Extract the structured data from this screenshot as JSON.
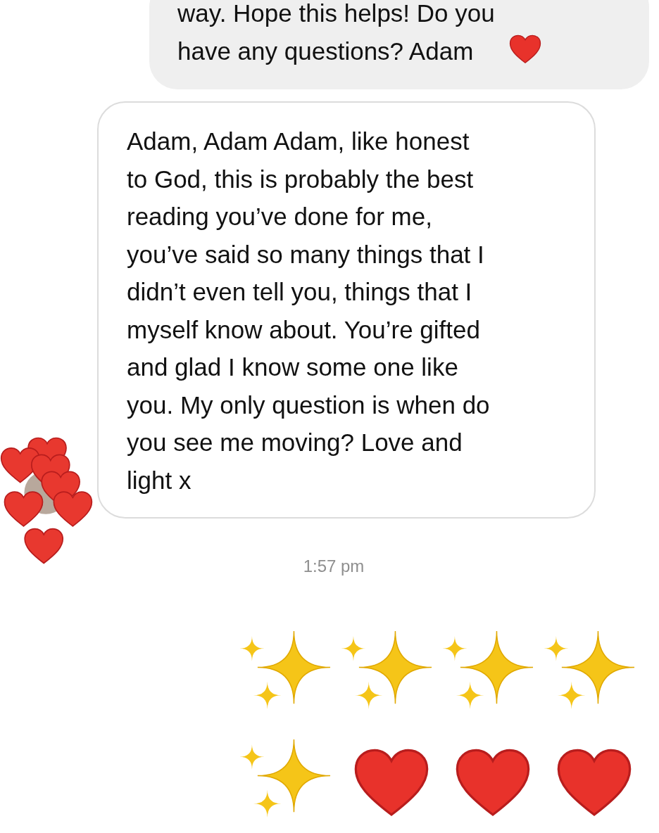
{
  "messages": [
    {
      "kind": "sent",
      "lines": [
        "way. Hope this helps! Do you",
        "have any questions? Adam"
      ],
      "reaction_heart": true
    },
    {
      "kind": "received",
      "lines": [
        "Adam, Adam Adam, like honest",
        "to God, this is probably the best",
        "reading you’ve done for me,",
        "you’ve said so many things that I",
        "didn’t even tell you, things that I",
        "myself know about. You’re gifted",
        "and glad I know some one like",
        "you. My only question is when do",
        "you see me moving? Love and",
        "light x"
      ],
      "reaction_heart": false
    },
    {
      "kind": "time",
      "text": "1:57 pm"
    },
    {
      "kind": "emoji",
      "rows": [
        [
          {
            "kind": "sparkles"
          },
          {
            "kind": "sparkles"
          },
          {
            "kind": "sparkles"
          },
          {
            "kind": "sparkles"
          }
        ],
        [
          {
            "kind": "sparkles"
          },
          {
            "kind": "heart"
          },
          {
            "kind": "heart"
          },
          {
            "kind": "heart"
          }
        ]
      ]
    }
  ]
}
